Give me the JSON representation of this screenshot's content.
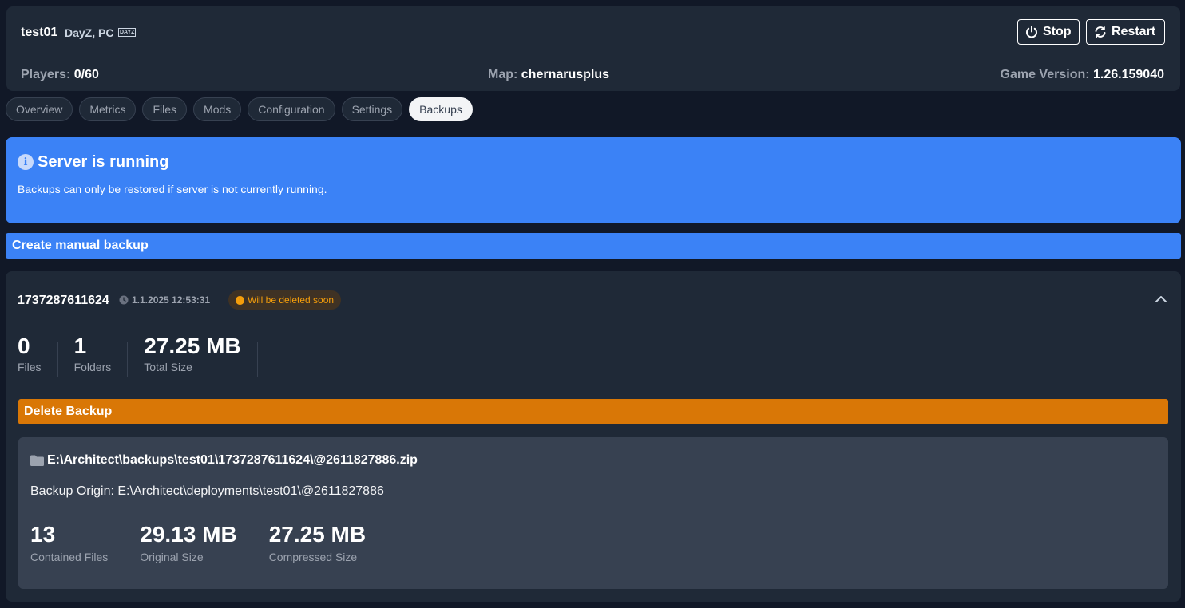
{
  "header": {
    "server_name": "test01",
    "game": "DayZ, PC",
    "game_badge": "DAYZ",
    "stop_label": "Stop",
    "restart_label": "Restart",
    "players_label": "Players:",
    "players_value": "0/60",
    "map_label": "Map:",
    "map_value": "chernarusplus",
    "version_label": "Game Version:",
    "version_value": "1.26.159040"
  },
  "tabs": [
    "Overview",
    "Metrics",
    "Files",
    "Mods",
    "Configuration",
    "Settings",
    "Backups"
  ],
  "active_tab": "Backups",
  "alert": {
    "title": "Server is running",
    "text": "Backups can only be restored if server is not currently running."
  },
  "create_backup_label": "Create manual backup",
  "backup": {
    "id": "1737287611624",
    "timestamp": "1.1.2025 12:53:31",
    "warning": "Will be deleted soon",
    "stats": [
      {
        "value": "0",
        "label": "Files"
      },
      {
        "value": "1",
        "label": "Folders"
      },
      {
        "value": "27.25 MB",
        "label": "Total Size"
      }
    ],
    "delete_label": "Delete Backup",
    "detail": {
      "path": "E:\\Architect\\backups\\test01\\1737287611624\\@2611827886.zip",
      "origin": "Backup Origin: E:\\Architect\\deployments\\test01\\@2611827886",
      "stats": [
        {
          "value": "13",
          "label": "Contained Files"
        },
        {
          "value": "29.13 MB",
          "label": "Original Size"
        },
        {
          "value": "27.25 MB",
          "label": "Compressed Size"
        }
      ]
    }
  },
  "colors": {
    "background": "#111827",
    "panel": "#1f2937",
    "accent": "#3b82f6",
    "danger": "#d97706",
    "warning": "#f59e0b"
  }
}
